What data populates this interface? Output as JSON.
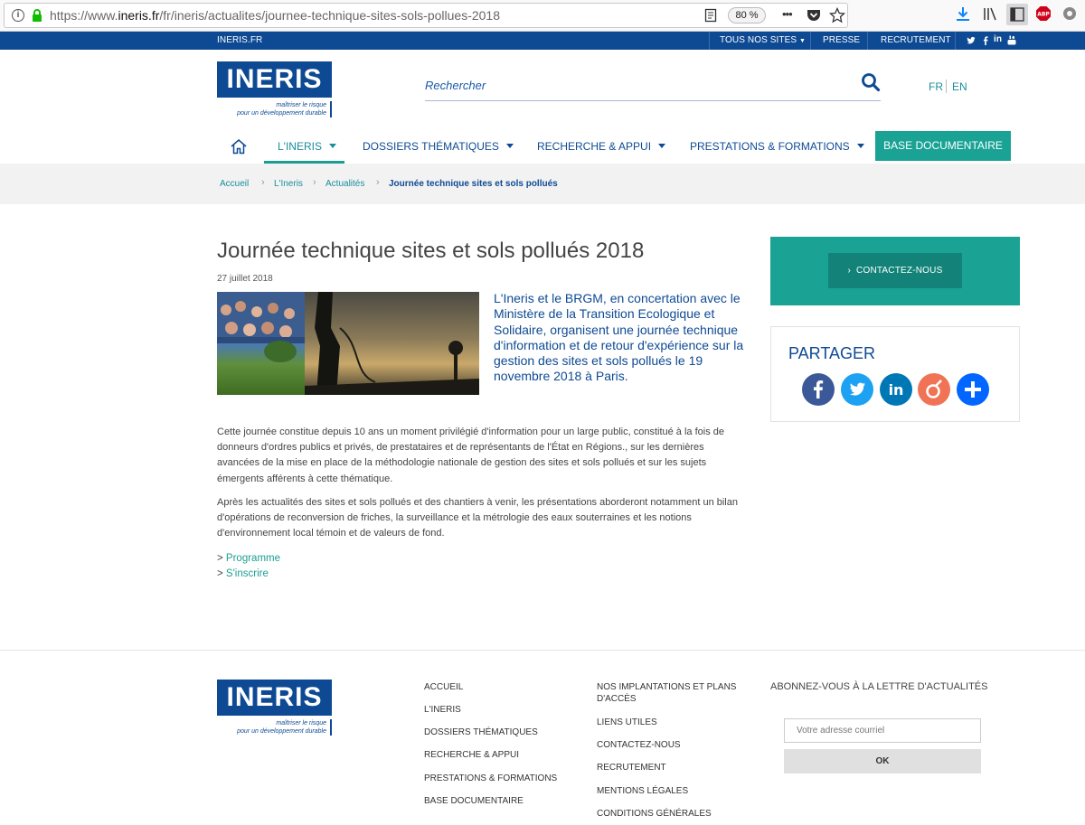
{
  "browser": {
    "url_prefix": "https://www.",
    "url_domain": "ineris.fr",
    "url_path": "/fr/ineris/actualites/journee-technique-sites-sols-pollues-2018",
    "zoom": "80 %",
    "more_label": "•••"
  },
  "topbar": {
    "site": "INERIS.FR",
    "all_sites": "TOUS NOS SITES",
    "press": "PRESSE",
    "recruitment": "RECRUTEMENT",
    "social": [
      "twitter-icon",
      "facebook-icon",
      "linkedin-icon",
      "youtube-icon"
    ]
  },
  "logo": {
    "name": "INERIS",
    "tagline_1": "maîtriser le risque",
    "tagline_2": "pour un développement durable"
  },
  "search": {
    "placeholder": "Rechercher"
  },
  "lang": {
    "fr": "FR",
    "en": "EN"
  },
  "nav": {
    "items": [
      {
        "label": "L'INERIS",
        "active": true
      },
      {
        "label": "DOSSIERS THÉMATIQUES",
        "active": false
      },
      {
        "label": "RECHERCHE & APPUI",
        "active": false
      },
      {
        "label": "PRESTATIONS & FORMATIONS",
        "active": false
      }
    ],
    "base_doc": "BASE DOCUMENTAIRE"
  },
  "breadcrumb": {
    "items": [
      "Accueil",
      "L'Ineris",
      "Actualités"
    ],
    "current": "Journée technique sites et sols pollués"
  },
  "article": {
    "title": "Journée technique sites et sols pollués 2018",
    "date": "27 juillet 2018",
    "intro": "L'Ineris et le BRGM, en concertation avec le Ministère de la Transition Ecologique et Solidaire, organisent une journée technique d'information et de retour d'expérience sur la gestion des sites et sols pollués le 19 novembre 2018 à Paris.",
    "paragraphs": [
      "Cette journée constitue depuis 10 ans un moment privilégié d'information pour un large public, constitué à la fois de donneurs d'ordres publics et privés, de prestataires et de représentants de l'État en Régions., sur les dernières avancées de la mise en place de la méthodologie nationale de gestion des sites et sols pollués et sur les sujets émergents afférents à cette thématique.",
      "Après les actualités des sites et sols pollués et des chantiers à venir, les présentations aborderont notamment un bilan d'opérations de reconversion de friches, la surveillance et la métrologie des eaux souterraines et les notions d'environnement local témoin et de valeurs de fond."
    ],
    "links": [
      "Programme",
      "S'inscrire"
    ]
  },
  "sidebar": {
    "contact": "CONTACTEZ-NOUS",
    "share_title": "PARTAGER",
    "share_buttons": [
      {
        "icon": "facebook-icon",
        "color": "#3b5998"
      },
      {
        "icon": "twitter-icon",
        "color": "#1da1f2"
      },
      {
        "icon": "linkedin-icon",
        "color": "#0077b5"
      },
      {
        "icon": "viadeo-icon",
        "color": "#f07355"
      },
      {
        "icon": "plus-icon",
        "color": "#0166ff"
      }
    ]
  },
  "footer": {
    "col1": [
      "ACCUEIL",
      "L'INERIS",
      "DOSSIERS THÉMATIQUES",
      "RECHERCHE & APPUI",
      "PRESTATIONS & FORMATIONS",
      "BASE DOCUMENTAIRE"
    ],
    "col2": [
      "NOS IMPLANTATIONS ET PLANS D'ACCÈS",
      "LIENS UTILES",
      "CONTACTEZ-NOUS",
      "RECRUTEMENT",
      "MENTIONS LÉGALES",
      "CONDITIONS GÉNÉRALES"
    ],
    "newsletter_title": "ABONNEZ-VOUS À LA LETTRE D'ACTUALITÉS",
    "newsletter_placeholder": "Votre adresse courriel",
    "newsletter_button": "OK"
  },
  "colors": {
    "brand_blue": "#0e4a94",
    "accent_teal": "#1aa395"
  }
}
